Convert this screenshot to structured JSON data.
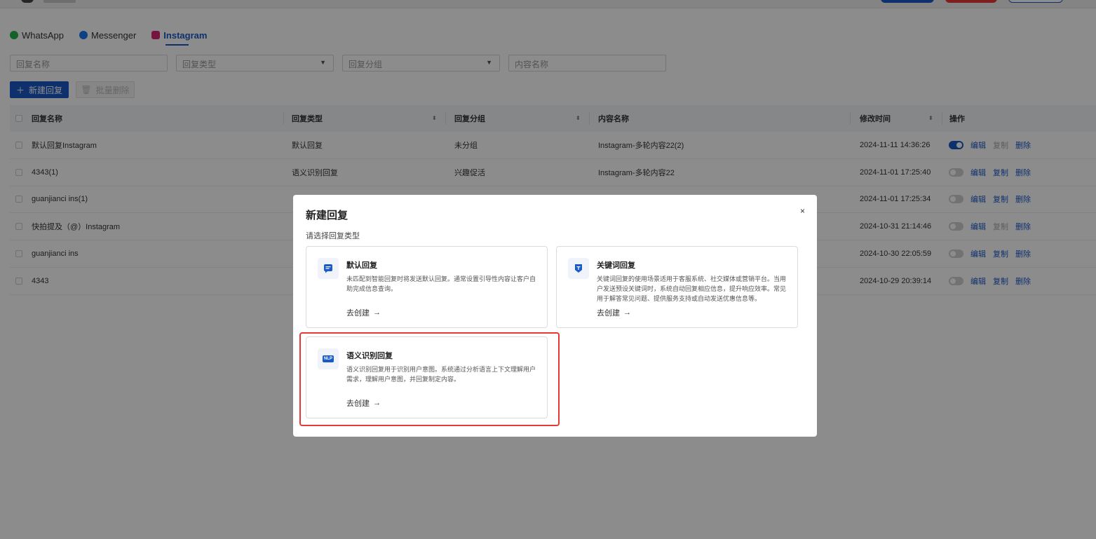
{
  "colors": {
    "accent": "#1a5ac8",
    "danger": "#e53935"
  },
  "tabs": [
    {
      "label": "WhatsApp",
      "icon": "whatsapp-icon",
      "color": "#25b14c"
    },
    {
      "label": "Messenger",
      "icon": "messenger-icon",
      "color": "#1877f2"
    },
    {
      "label": "Instagram",
      "icon": "instagram-icon",
      "color": "#d62976",
      "active": true
    }
  ],
  "filters": {
    "name_placeholder": "回复名称",
    "type_placeholder": "回复类型",
    "group_placeholder": "回复分组",
    "content_placeholder": "内容名称"
  },
  "toolbar": {
    "new_label": "新建回复",
    "batch_delete_label": "批量删除"
  },
  "table": {
    "headers": {
      "name": "回复名称",
      "type": "回复类型",
      "group": "回复分组",
      "content": "内容名称",
      "time": "修改时间",
      "ops": "操作"
    },
    "actions": {
      "edit": "编辑",
      "copy": "复制",
      "delete": "删除"
    },
    "rows": [
      {
        "name": "默认回复Instagram",
        "type": "默认回复",
        "group": "未分组",
        "content": "Instagram-多轮内容22(2)",
        "time": "2024-11-11 14:36:26",
        "enabled": true,
        "copy_disabled": true
      },
      {
        "name": "4343(1)",
        "type": "语义识别回复",
        "group": "兴趣促活",
        "content": "Instagram-多轮内容22",
        "time": "2024-11-01 17:25:40",
        "enabled": false,
        "copy_disabled": false
      },
      {
        "name": "guanjianci ins(1)",
        "type": "",
        "group": "",
        "content": "",
        "time": "2024-11-01 17:25:34",
        "enabled": false,
        "copy_disabled": false
      },
      {
        "name": "快拍提及（@）Instagram",
        "type": "",
        "group": "",
        "content": "",
        "time": "2024-10-31 21:14:46",
        "enabled": false,
        "copy_disabled": true
      },
      {
        "name": "guanjianci ins",
        "type": "",
        "group": "",
        "content": "",
        "time": "2024-10-30 22:05:59",
        "enabled": false,
        "copy_disabled": false
      },
      {
        "name": "4343",
        "type": "",
        "group": "",
        "content": "",
        "time": "2024-10-29 20:39:14",
        "enabled": false,
        "copy_disabled": false
      }
    ]
  },
  "modal": {
    "title": "新建回复",
    "close": "×",
    "subtitle": "请选择回复类型",
    "cards": [
      {
        "title": "默认回复",
        "icon": "chat-bubble-icon",
        "desc": "未匹配到智能回复时将发送默认回复。通常设置引导性内容让客户自助完成信息查询。",
        "link": "去创建"
      },
      {
        "title": "关键词回复",
        "icon": "keyword-icon",
        "desc": "关键词回复的使用场景适用于客服系统、社交媒体或营销平台。当用户发送预设关键词时，系统自动回复相应信息，提升响应效率。常见用于解答常见问题、提供服务支持或自动发送优惠信息等。",
        "link": "去创建"
      },
      {
        "title": "语义识别回复",
        "icon": "nlp-icon",
        "icon_text": "NLP",
        "desc": "语义识别回复用于识别用户意图。系统通过分析语言上下文理解用户需求，理解用户意图，并回复制定内容。",
        "link": "去创建"
      }
    ]
  }
}
